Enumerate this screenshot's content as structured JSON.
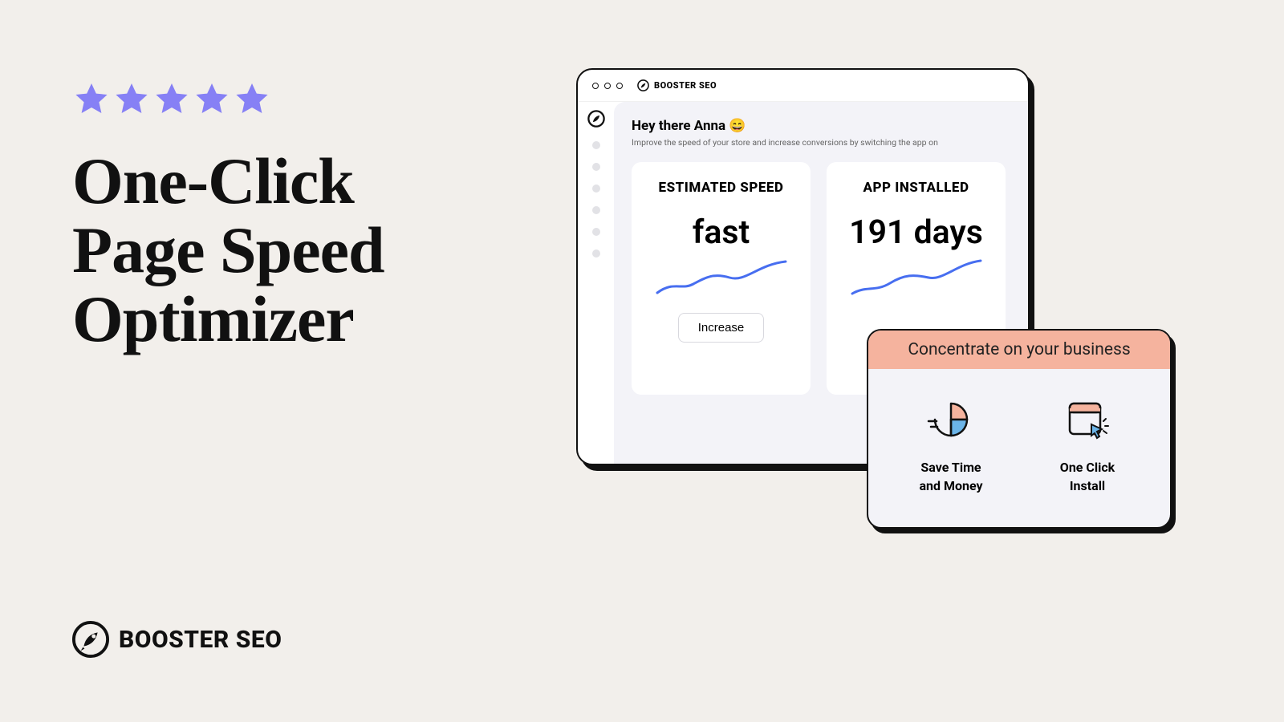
{
  "stars": 5,
  "headline_l1": "One-Click",
  "headline_l2": "Page Speed",
  "headline_l3": "Optimizer",
  "brand": "BOOSTER SEO",
  "window": {
    "brand": "BOOSTER SEO",
    "greeting": "Hey there Anna 😄",
    "subtext": "Improve the speed of your store and increase conversions by switching the app on",
    "card1_title": "ESTIMATED SPEED",
    "card1_value": "fast",
    "card1_button": "Increase",
    "card2_title": "APP INSTALLED",
    "card2_value": "191 days"
  },
  "overlay": {
    "header": "Concentrate on your business",
    "feat1_l1": "Save Time",
    "feat1_l2": "and Money",
    "feat2_l1": "One Click",
    "feat2_l2": "Install"
  }
}
